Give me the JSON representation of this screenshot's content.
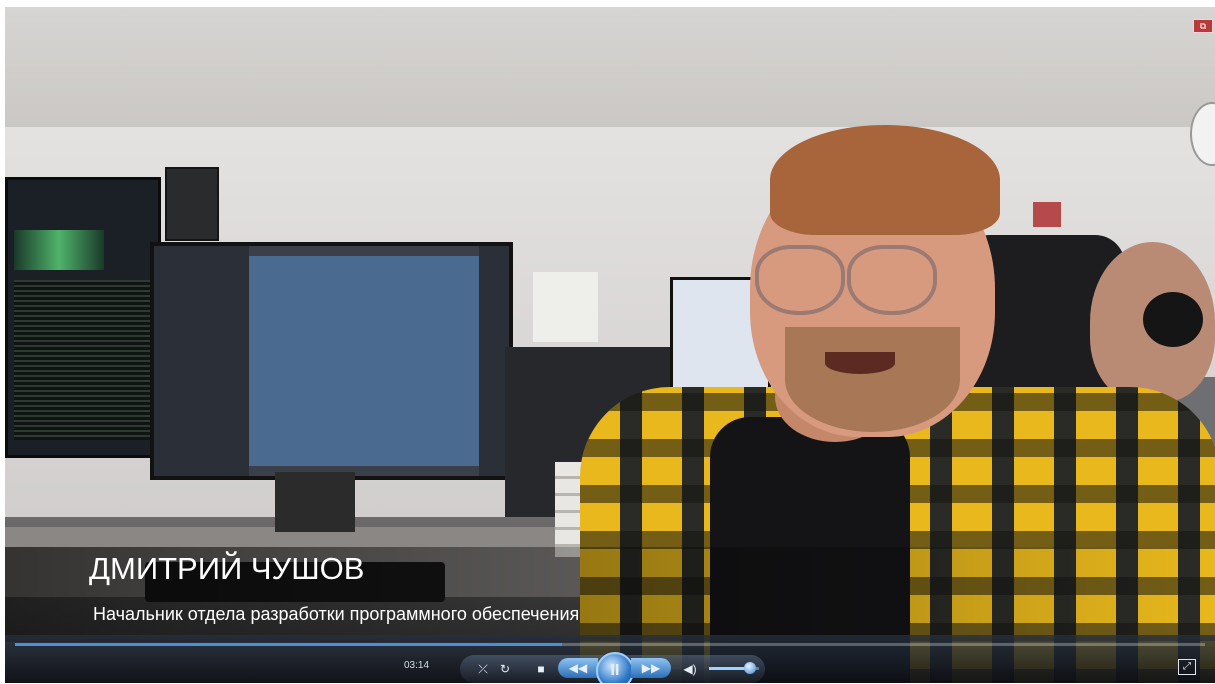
{
  "video": {
    "caption_name": "ДМИТРИЙ ЧУШОВ",
    "caption_title": "Начальник отдела разработки программного обеспечения"
  },
  "player": {
    "time": "03:14",
    "progress": 0.46,
    "volume": 0.82,
    "state": "playing",
    "icons": {
      "shuffle": "shuffle-icon",
      "repeat": "repeat-icon",
      "stop": "stop-icon",
      "previous": "previous-icon",
      "pause": "pause-icon",
      "next": "next-icon",
      "volume": "volume-icon",
      "fullscreen": "fullscreen-icon",
      "window": "window-control-icon"
    },
    "glyphs": {
      "shuffle": "⤫",
      "repeat": "↻",
      "stop": "■",
      "previous": "◀◀",
      "pause": "II",
      "next": "▶▶",
      "volume": "◀)",
      "fullscreen": "⤢",
      "window": "⧉"
    },
    "colors": {
      "accent": "#4a90d9",
      "bar": "#1a212c",
      "text": "#ffffff"
    }
  }
}
